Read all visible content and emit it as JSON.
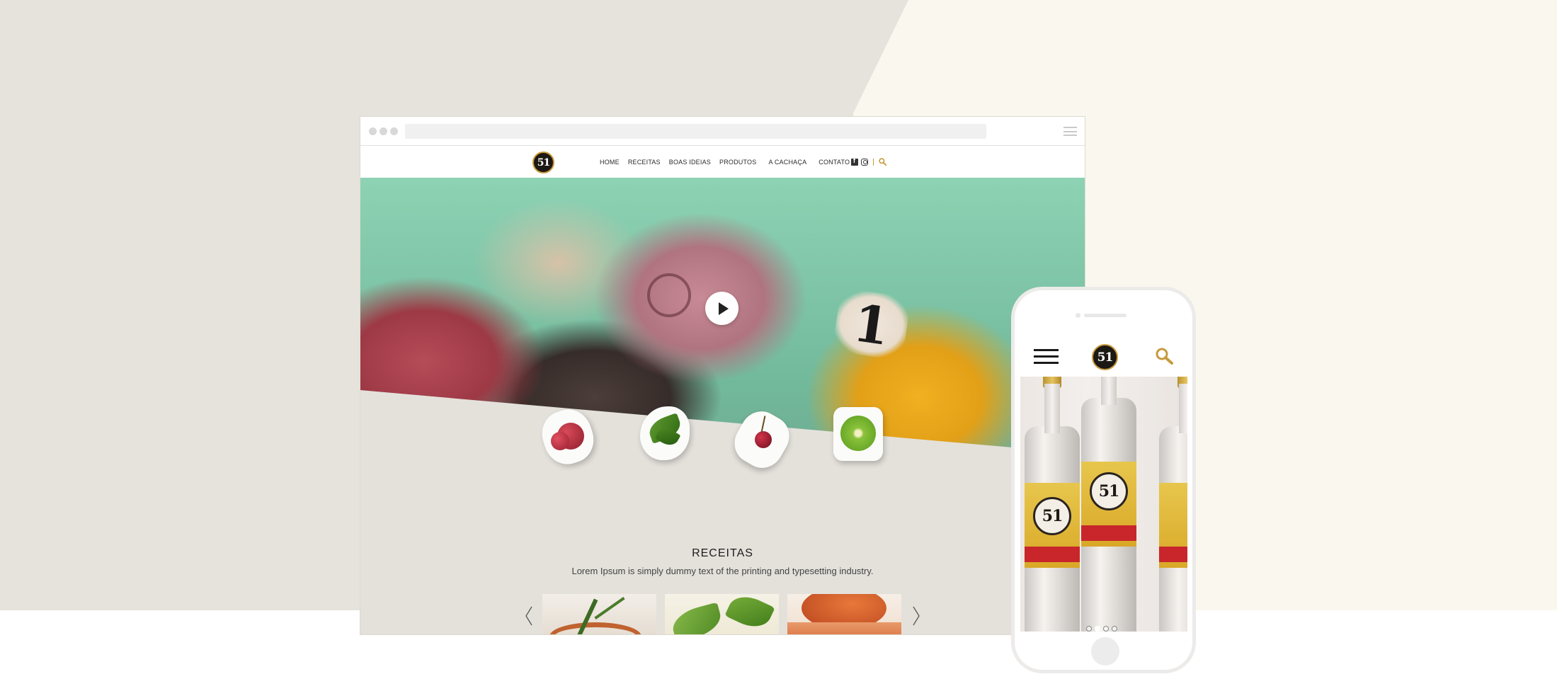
{
  "desktop": {
    "logo_text": "51",
    "nav": [
      "HOME",
      "RECEITAS",
      "BOAS IDEIAS",
      "PRODUTOS",
      "A CACHAÇA",
      "CONTATO"
    ],
    "hero": {
      "ball_number": "1"
    },
    "section": {
      "title": "RECEITAS",
      "text": "Lorem Ipsum is simply dummy text of the printing and typesetting industry."
    },
    "ingredient_icons": [
      "grapes-icon",
      "basil-icon",
      "cherry-icon",
      "kiwi-icon"
    ]
  },
  "phone": {
    "logo_text": "51",
    "bottle_label": "51",
    "carousel": {
      "slides": 4,
      "active": 2
    }
  },
  "colors": {
    "accent_gold": "#c79a3d",
    "background_gray": "#e6e3dd",
    "background_cream": "#faf7ef",
    "logo_dark": "#1c1814"
  }
}
